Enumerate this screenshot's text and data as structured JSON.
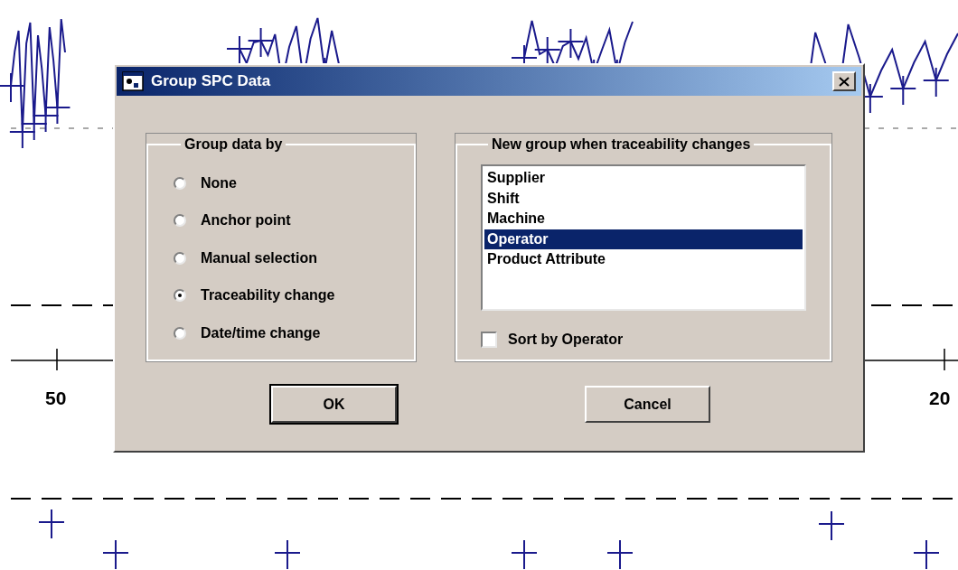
{
  "chart": {
    "tick_labels": [
      "50",
      "20"
    ]
  },
  "dialog": {
    "title": "Group SPC Data",
    "group_by": {
      "label": "Group data by",
      "options": [
        {
          "label": "None",
          "selected": false
        },
        {
          "label": "Anchor point",
          "selected": false
        },
        {
          "label": "Manual selection",
          "selected": false
        },
        {
          "label": "Traceability change",
          "selected": true
        },
        {
          "label": "Date/time change",
          "selected": false
        }
      ]
    },
    "traceability": {
      "label": "New group when traceability changes",
      "items": [
        {
          "label": "Supplier",
          "selected": false
        },
        {
          "label": "Shift",
          "selected": false
        },
        {
          "label": "Machine",
          "selected": false
        },
        {
          "label": "Operator",
          "selected": true
        },
        {
          "label": "Product Attribute",
          "selected": false
        }
      ],
      "sort_checkbox": {
        "label": "Sort by Operator",
        "checked": false
      }
    },
    "buttons": [
      {
        "label": "OK",
        "default": true
      },
      {
        "label": "Cancel",
        "default": false
      }
    ]
  }
}
